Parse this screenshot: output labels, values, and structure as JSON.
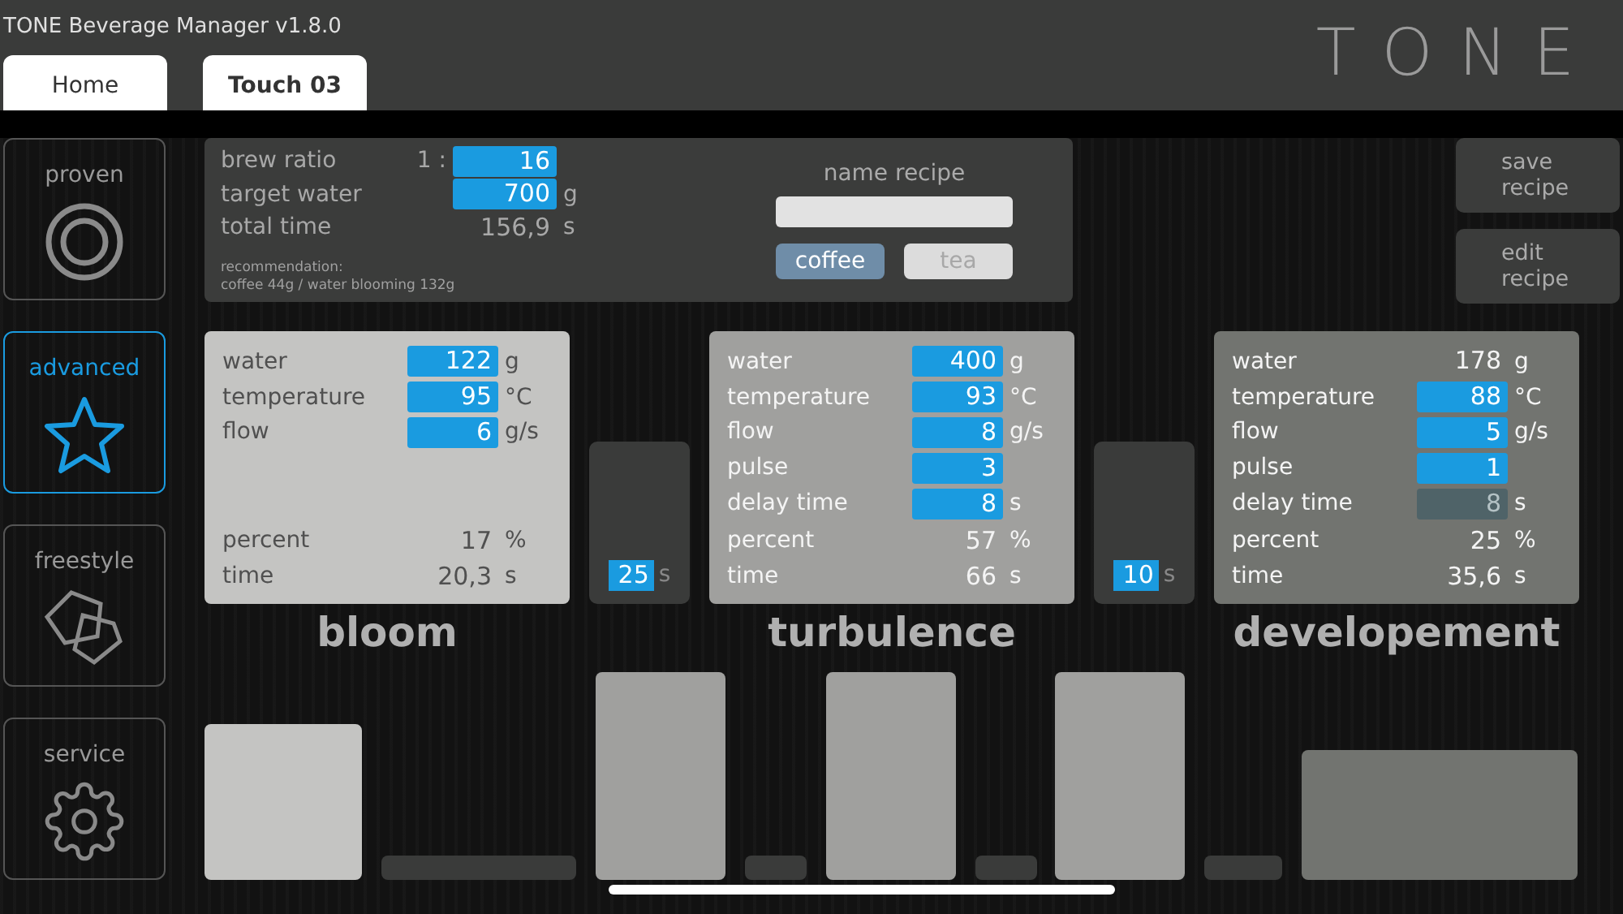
{
  "window": {
    "title": "TONE Beverage Manager v1.8.0"
  },
  "logo": "TONE",
  "tabs": [
    {
      "label": "Home",
      "selected": false
    },
    {
      "label": "Touch 03",
      "selected": true
    }
  ],
  "sidebar": {
    "items": [
      {
        "label": "proven",
        "selected": false
      },
      {
        "label": "advanced",
        "selected": true
      },
      {
        "label": "freestyle",
        "selected": false
      },
      {
        "label": "service",
        "selected": false
      }
    ]
  },
  "recipe": {
    "rows": [
      {
        "label": "brew ratio",
        "prefix": "1 :",
        "value": "16",
        "unit": "",
        "kind": "input"
      },
      {
        "label": "target water",
        "prefix": "",
        "value": "700",
        "unit": "g",
        "kind": "input"
      },
      {
        "label": "total time",
        "prefix": "",
        "value": "156,9",
        "unit": "s",
        "kind": "text"
      }
    ],
    "recommendation": [
      "recommendation:",
      "coffee 44g / water blooming 132g"
    ],
    "name_label": "name recipe",
    "types": [
      {
        "label": "coffee",
        "selected": true
      },
      {
        "label": "tea",
        "selected": false
      }
    ]
  },
  "actions": [
    "save recipe",
    "edit recipe"
  ],
  "phases": [
    {
      "title": "bloom",
      "rows": [
        {
          "label": "water",
          "value": "122",
          "unit": "g",
          "kind": "input"
        },
        {
          "label": "temperature",
          "value": "95",
          "unit": "°C",
          "kind": "input"
        },
        {
          "label": "flow",
          "value": "6",
          "unit": "g/s",
          "kind": "input"
        }
      ],
      "totals": [
        {
          "label": "percent",
          "value": "17",
          "unit": "%"
        },
        {
          "label": "time",
          "value": "20,3",
          "unit": "s"
        }
      ],
      "pause": {
        "value": "25",
        "unit": "s"
      }
    },
    {
      "title": "turbulence",
      "rows": [
        {
          "label": "water",
          "value": "400",
          "unit": "g",
          "kind": "input"
        },
        {
          "label": "temperature",
          "value": "93",
          "unit": "°C",
          "kind": "input"
        },
        {
          "label": "flow",
          "value": "8",
          "unit": "g/s",
          "kind": "input"
        },
        {
          "label": "pulse",
          "value": "3",
          "unit": "",
          "kind": "input"
        },
        {
          "label": "delay time",
          "value": "8",
          "unit": "s",
          "kind": "input"
        }
      ],
      "totals": [
        {
          "label": "percent",
          "value": "57",
          "unit": "%"
        },
        {
          "label": "time",
          "value": "66",
          "unit": "s"
        }
      ],
      "pause": {
        "value": "10",
        "unit": "s"
      }
    },
    {
      "title": "developement",
      "rows": [
        {
          "label": "water",
          "value": "178",
          "unit": "g",
          "kind": "text"
        },
        {
          "label": "temperature",
          "value": "88",
          "unit": "°C",
          "kind": "input"
        },
        {
          "label": "flow",
          "value": "5",
          "unit": "g/s",
          "kind": "input"
        },
        {
          "label": "pulse",
          "value": "1",
          "unit": "",
          "kind": "input"
        },
        {
          "label": "delay time",
          "value": "8",
          "unit": "s",
          "kind": "disabled"
        }
      ],
      "totals": [
        {
          "label": "percent",
          "value": "25",
          "unit": "%"
        },
        {
          "label": "time",
          "value": "35,6",
          "unit": "s"
        }
      ]
    }
  ]
}
